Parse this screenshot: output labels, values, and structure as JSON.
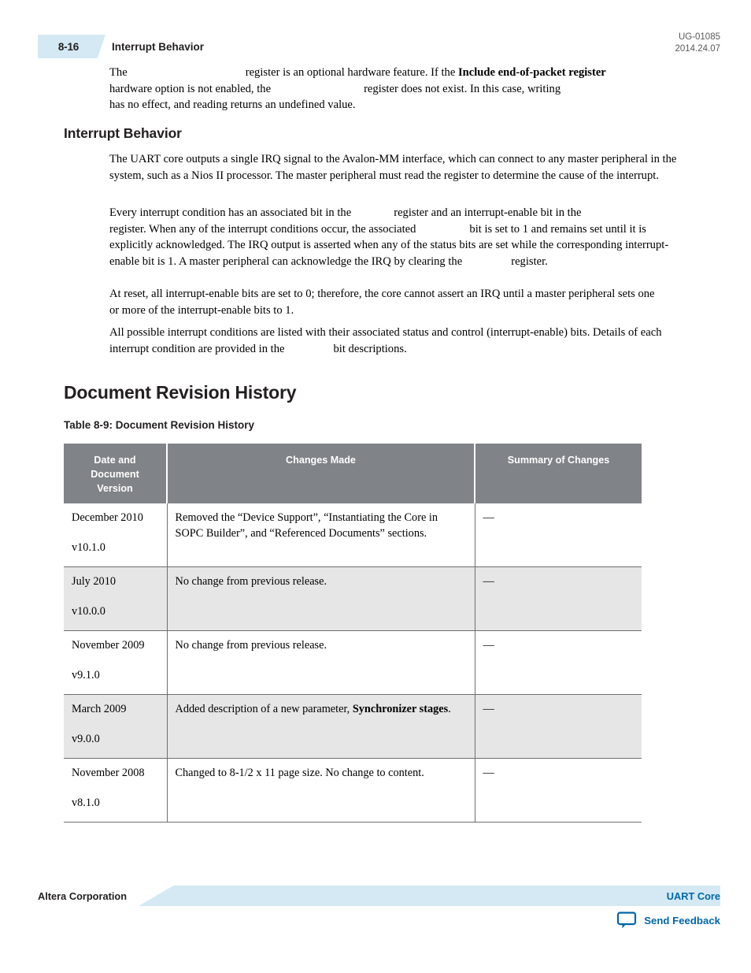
{
  "header": {
    "page_number": "8-16",
    "running_head": "Interrupt Behavior",
    "doc_id": "UG-01085",
    "doc_date": "2014.24.07",
    "tab_color": "#d4e9f4"
  },
  "intro_paragraph": {
    "part1": "The",
    "part2": "register is an optional hardware feature. If the",
    "bold1": "Include end-of-packet register",
    "part3": "hardware option is not enabled, the",
    "part4": "register does not exist. In this case, writing",
    "part5": "has no effect, and reading returns an undefined value."
  },
  "section": {
    "heading": "Interrupt Behavior",
    "paragraphs": [
      {
        "text": "The UART core outputs a single IRQ signal to the Avalon-MM interface, which can connect to any master peripheral in the system, such as a Nios II processor. The master peripheral must read the register to determine the cause of the interrupt."
      },
      {
        "p1": "Every interrupt condition has an associated bit in the",
        "p2": "register and an interrupt-enable bit in the",
        "p3": "register. When any of the interrupt conditions occur, the associated",
        "p4": "bit is set to 1 and remains set until it is explicitly acknowledged. The IRQ output is asserted when any of the status bits are set while the corresponding interrupt-enable bit is 1. A master peripheral can acknowledge the IRQ by clearing the",
        "p5": "register."
      },
      {
        "text": "At reset, all interrupt-enable bits are set to 0; therefore, the core cannot assert an IRQ until a master peripheral sets one or more of the interrupt-enable bits to 1."
      },
      {
        "p1": "All possible interrupt conditions are listed with their associated status and control (interrupt-enable) bits. Details of each interrupt condition are provided in the",
        "p2": "bit descriptions."
      }
    ]
  },
  "revision_history": {
    "chapter_heading": "Document Revision History",
    "table_caption": "Table 8-9: Document Revision History",
    "header_bg": "#808387",
    "shaded_row_bg": "#e6e6e6",
    "columns": [
      "Date and Document Version",
      "Changes Made",
      "Summary of Changes"
    ],
    "column_header_lines": [
      [
        "Date and",
        "Document",
        "Version"
      ],
      [
        "Changes Made"
      ],
      [
        "Summary of Changes"
      ]
    ],
    "rows": [
      {
        "date": "December 2010",
        "version": "v10.1.0",
        "changes_plain": "Removed the “Device Support”, “Instantiating the Core in SOPC Builder”, and “Referenced Documents” sections.",
        "summary": "—",
        "shaded": false
      },
      {
        "date": "July 2010",
        "version": "v10.0.0",
        "changes_plain": "No change from previous release.",
        "summary": "—",
        "shaded": true
      },
      {
        "date": "November 2009",
        "version": "v9.1.0",
        "changes_plain": "No change from previous release.",
        "summary": "—",
        "shaded": false
      },
      {
        "date": "March 2009",
        "version": "v9.0.0",
        "changes_prefix": "Added description of a new parameter,",
        "changes_bold": "Synchronizer stages",
        "changes_suffix": ".",
        "summary": "—",
        "shaded": true
      },
      {
        "date": "November 2008",
        "version": "v8.1.0",
        "changes_plain": "Changed to 8-1/2 x 11 page size. No change to content.",
        "summary": "—",
        "shaded": false
      }
    ]
  },
  "footer": {
    "company": "Altera Corporation",
    "doc_title": "UART Core",
    "feedback_label": "Send Feedback",
    "link_color": "#0066a8",
    "banner_color": "#d4e9f4"
  }
}
